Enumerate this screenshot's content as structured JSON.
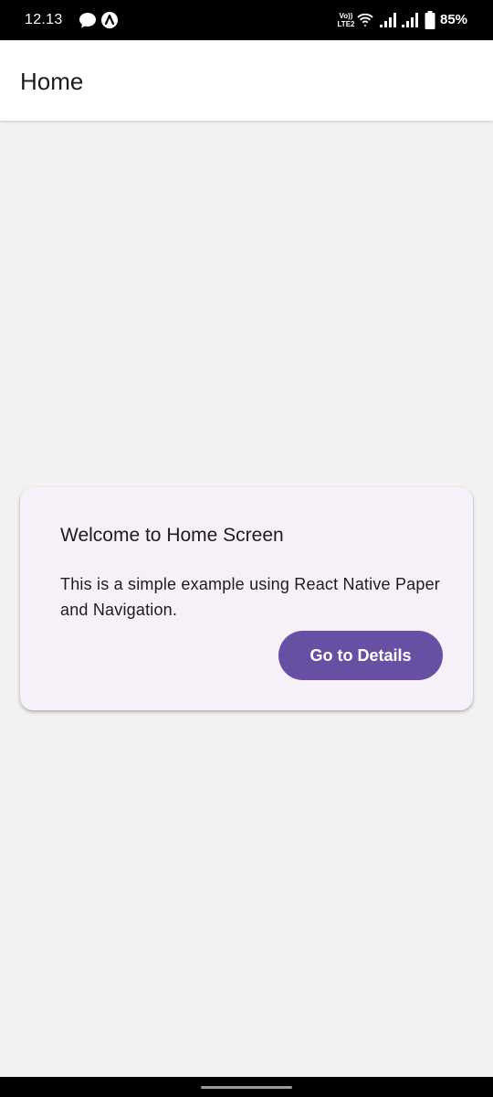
{
  "status_bar": {
    "time": "12.13",
    "battery_percent": "85%",
    "icons": [
      "message-bubble-icon",
      "notification-app-icon",
      "volte-icon",
      "wifi-icon",
      "signal-icon",
      "signal-icon",
      "battery-icon"
    ],
    "volte_line1": "Vo))",
    "volte_line2": "LTE2"
  },
  "app_bar": {
    "title": "Home"
  },
  "card": {
    "title": "Welcome to Home Screen",
    "body": "This is a simple example using React Native Paper and Navigation.",
    "button_label": "Go to Details"
  },
  "colors": {
    "accent": "#6750a4",
    "background": "#f2f2f2",
    "card_background": "#f6f1f8"
  }
}
